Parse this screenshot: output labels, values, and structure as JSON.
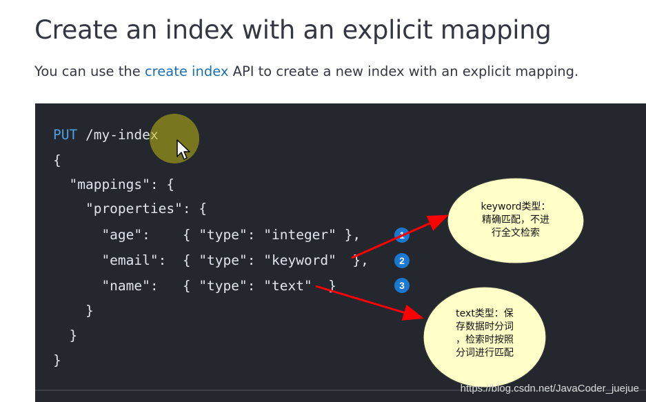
{
  "page": {
    "title": "Create an index with an explicit mapping",
    "intro_before": "You can use the ",
    "intro_link": "create index",
    "intro_after": " API to create a new index with an explicit mapping."
  },
  "code": {
    "method": "PUT",
    "path": " /my-index",
    "lines": [
      "{",
      "  \"mappings\": {",
      "    \"properties\": {",
      "      \"age\":    { \"type\": \"integer\" },",
      "      \"email\":  { \"type\": \"keyword\"  },",
      "      \"name\":   { \"type\": \"text\"  }",
      "    }",
      "  }",
      "}"
    ],
    "callout_numbers": [
      "1",
      "2",
      "3"
    ]
  },
  "annotations": {
    "keyword_note": "keyword类型：\n精确匹配，不进\n行全文检索",
    "text_note": "text类型：保\n存数据时分词\n，检索时按照\n分词进行匹配",
    "bubble_fill": "#ffffc8",
    "arrow_color": "#ff0000"
  },
  "watermark": "https://blog.csdn.net/JavaCoder_juejue"
}
